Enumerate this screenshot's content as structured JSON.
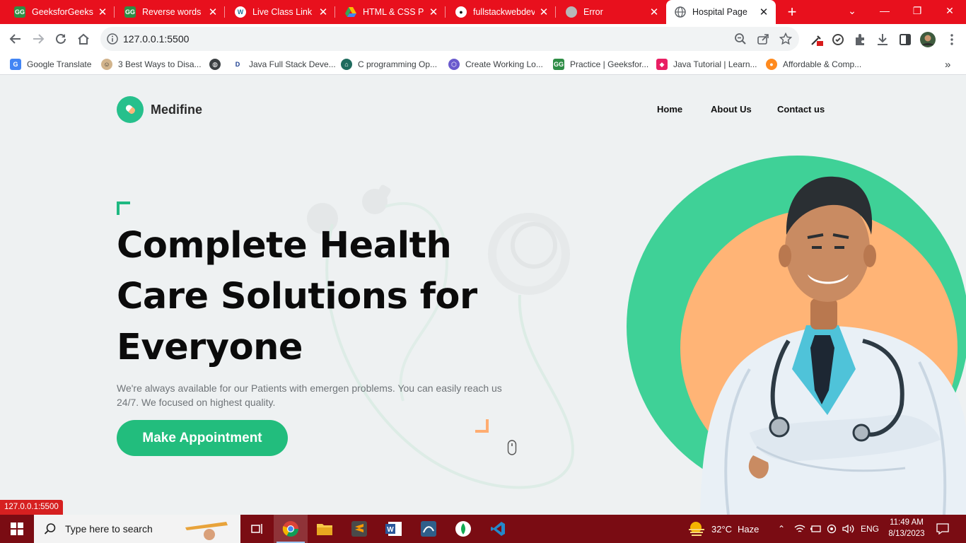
{
  "browser": {
    "tabs": [
      {
        "title": "GeeksforGeeks | A",
        "favicon": "geeksforgeeks-icon"
      },
      {
        "title": "Reverse words in",
        "favicon": "geeksforgeeks-icon"
      },
      {
        "title": "Live Class Link - F",
        "favicon": "wordpress-icon"
      },
      {
        "title": "HTML & CSS Proj",
        "favicon": "google-drive-icon"
      },
      {
        "title": "fullstackwebdeve",
        "favicon": "github-icon"
      },
      {
        "title": "Error",
        "favicon": "globe-icon"
      },
      {
        "title": "Hospital Page",
        "favicon": "globe-icon",
        "active": true
      }
    ],
    "url": "127.0.0.1:5500",
    "bookmarks": [
      {
        "label": "Google Translate",
        "icon": "google-translate-icon"
      },
      {
        "label": "3 Best Ways to Disa...",
        "icon": "avatar-icon"
      },
      {
        "label": "",
        "icon": "globe-icon"
      },
      {
        "label": "Java Full Stack Deve...",
        "icon": "d-logo-icon"
      },
      {
        "label": "C programming Op...",
        "icon": "geo-icon"
      },
      {
        "label": "Create Working Lo...",
        "icon": "hexagon-icon"
      },
      {
        "label": "Practice | Geeksfor...",
        "icon": "geeksforgeeks-icon"
      },
      {
        "label": "Java Tutorial | Learn...",
        "icon": "cube-icon"
      },
      {
        "label": "Affordable & Comp...",
        "icon": "orange-circle-icon"
      }
    ],
    "status_url": "127.0.0.1:5500"
  },
  "site": {
    "brand": "Medifine",
    "nav": [
      "Home",
      "About Us",
      "Contact us"
    ],
    "hero_title": "Complete Health Care Solutions for Everyone",
    "hero_subtitle": "We're always available for our Patients with emergen problems. You can easily reach us 24/7. We focused on highest quality.",
    "cta": "Make Appointment"
  },
  "taskbar": {
    "search_placeholder": "Type here to search",
    "weather": {
      "temp": "32°C",
      "condition": "Haze"
    },
    "language": "ENG",
    "time": "11:49 AM",
    "date": "8/13/2023"
  },
  "colors": {
    "accent": "#22bd7d",
    "accent_orange": "#ffad71",
    "chrome_red": "#e8101d",
    "taskbar": "#7a0c13"
  }
}
